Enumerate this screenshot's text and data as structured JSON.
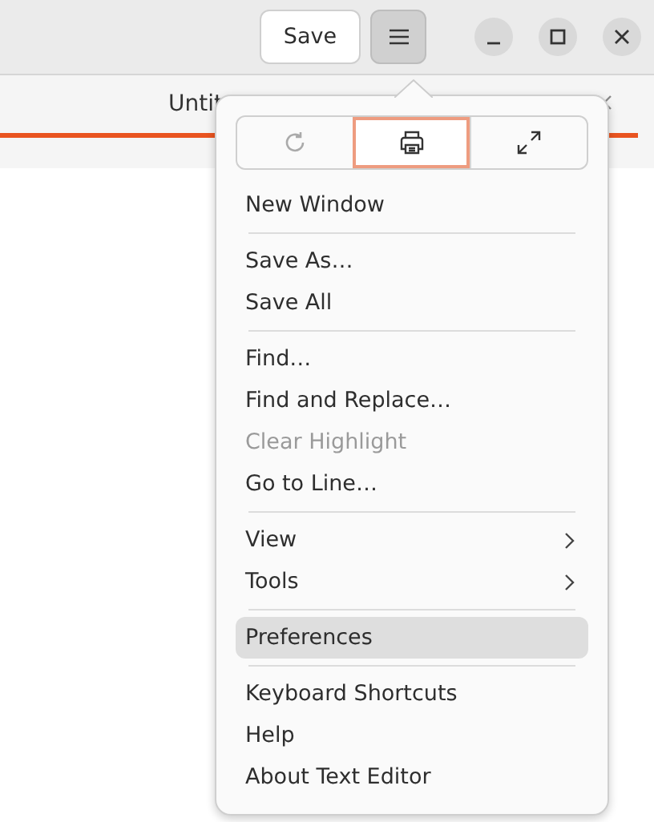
{
  "header": {
    "save_button": "Save",
    "menu_button_open": true
  },
  "tab": {
    "title": "Untit",
    "selected": true
  },
  "menu": {
    "icon_buttons": [
      {
        "kind": "reload",
        "disabled": true,
        "focused": false
      },
      {
        "kind": "print",
        "disabled": false,
        "focused": true
      },
      {
        "kind": "fullscreen",
        "disabled": false,
        "focused": false
      }
    ],
    "sections": [
      [
        {
          "label": "New Window",
          "disabled": false,
          "submenu": false,
          "selected": false
        }
      ],
      [
        {
          "label": "Save As…",
          "disabled": false,
          "submenu": false,
          "selected": false
        },
        {
          "label": "Save All",
          "disabled": false,
          "submenu": false,
          "selected": false
        }
      ],
      [
        {
          "label": "Find…",
          "disabled": false,
          "submenu": false,
          "selected": false
        },
        {
          "label": "Find and Replace…",
          "disabled": false,
          "submenu": false,
          "selected": false
        },
        {
          "label": "Clear Highlight",
          "disabled": true,
          "submenu": false,
          "selected": false
        },
        {
          "label": "Go to Line…",
          "disabled": false,
          "submenu": false,
          "selected": false
        }
      ],
      [
        {
          "label": "View",
          "disabled": false,
          "submenu": true,
          "selected": false
        },
        {
          "label": "Tools",
          "disabled": false,
          "submenu": true,
          "selected": false
        }
      ],
      [
        {
          "label": "Preferences",
          "disabled": false,
          "submenu": false,
          "selected": true
        }
      ],
      [
        {
          "label": "Keyboard Shortcuts",
          "disabled": false,
          "submenu": false,
          "selected": false
        },
        {
          "label": "Help",
          "disabled": false,
          "submenu": false,
          "selected": false
        },
        {
          "label": "About Text Editor",
          "disabled": false,
          "submenu": false,
          "selected": false
        }
      ]
    ]
  }
}
